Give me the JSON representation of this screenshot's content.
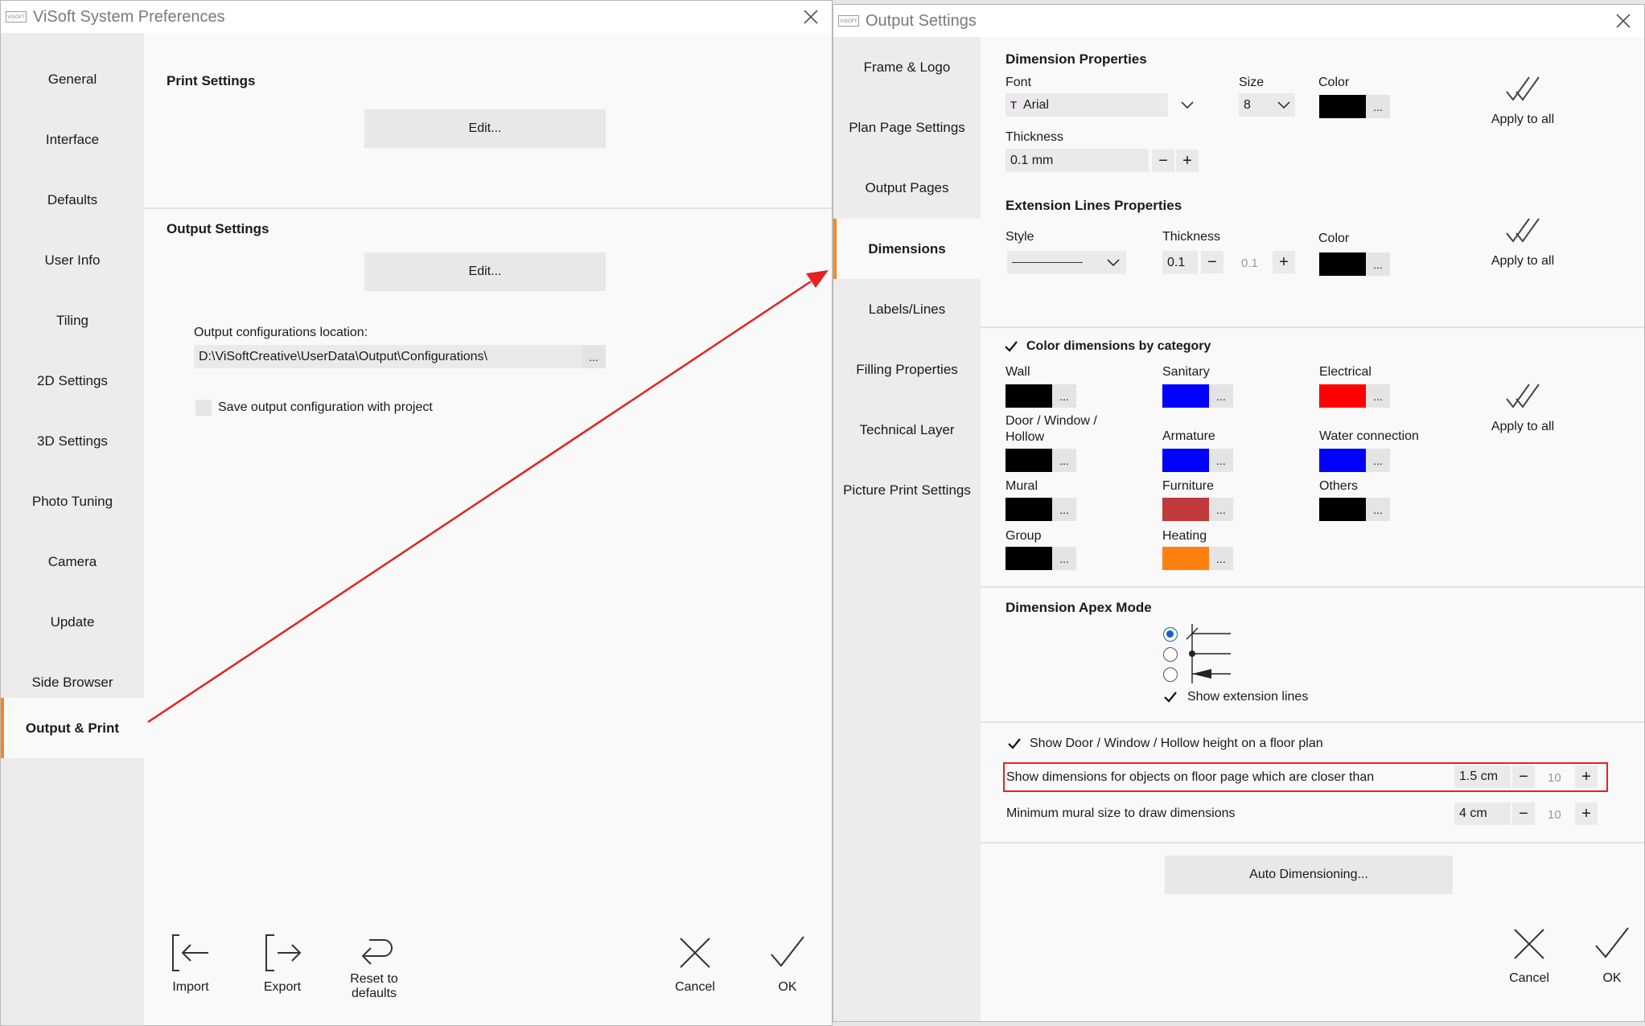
{
  "left_window": {
    "title": "ViSoft System Preferences",
    "logo": "VISOFT",
    "nav": [
      {
        "label": "General"
      },
      {
        "label": "Interface"
      },
      {
        "label": "Defaults"
      },
      {
        "label": "User Info"
      },
      {
        "label": "Tiling"
      },
      {
        "label": "2D Settings"
      },
      {
        "label": "3D Settings"
      },
      {
        "label": "Photo Tuning"
      },
      {
        "label": "Camera"
      },
      {
        "label": "Update"
      },
      {
        "label": "Side Browser"
      },
      {
        "label": "Output & Print"
      }
    ],
    "active_nav": "Output & Print",
    "print_settings": {
      "title": "Print Settings",
      "edit_label": "Edit..."
    },
    "output_settings": {
      "title": "Output Settings",
      "edit_label": "Edit...",
      "location_label": "Output configurations location:",
      "location_value": "D:\\ViSoftCreative\\UserData\\Output\\Configurations\\",
      "browse_label": "...",
      "save_with_project_label": "Save output configuration with project",
      "save_with_project_checked": false
    },
    "footer": {
      "import_label": "Import",
      "export_label": "Export",
      "reset_label": "Reset to\ndefaults",
      "cancel_label": "Cancel",
      "ok_label": "OK"
    }
  },
  "right_window": {
    "title": "Output Settings",
    "logo": "VISOFT",
    "nav": [
      {
        "label": "Frame & Logo"
      },
      {
        "label": "Plan Page Settings"
      },
      {
        "label": "Output Pages"
      },
      {
        "label": "Dimensions"
      },
      {
        "label": "Labels/Lines"
      },
      {
        "label": "Filling Properties"
      },
      {
        "label": "Technical Layer"
      },
      {
        "label": "Picture Print Settings"
      }
    ],
    "active_nav": "Dimensions",
    "dimension_properties": {
      "title": "Dimension Properties",
      "font_label": "Font",
      "font_value": "Arial",
      "size_label": "Size",
      "size_value": "8",
      "color_label": "Color",
      "color_value": "#000000",
      "thickness_label": "Thickness",
      "thickness_value": "0.1 mm",
      "apply_label": "Apply to all"
    },
    "extension_lines": {
      "title": "Extension Lines Properties",
      "style_label": "Style",
      "thickness_label": "Thickness",
      "thickness_value": "0.1",
      "thickness_step": "0.1",
      "color_label": "Color",
      "color_value": "#000000",
      "apply_label": "Apply to all"
    },
    "color_by_category": {
      "label": "Color dimensions by category",
      "checked": true,
      "apply_label": "Apply to all",
      "categories": [
        {
          "label": "Wall",
          "color": "#000000"
        },
        {
          "label": "Sanitary",
          "color": "#0000ff"
        },
        {
          "label": "Electrical",
          "color": "#ff0000"
        },
        {
          "label": "Door / Window / Hollow",
          "color": "#000000"
        },
        {
          "label": "Armature",
          "color": "#0000ff"
        },
        {
          "label": "Water connection",
          "color": "#0000ff"
        },
        {
          "label": "Mural",
          "color": "#000000"
        },
        {
          "label": "Furniture",
          "color": "#c0393b"
        },
        {
          "label": "Others",
          "color": "#000000"
        },
        {
          "label": "Group",
          "color": "#000000"
        },
        {
          "label": "Heating",
          "color": "#ff7f0e"
        }
      ]
    },
    "apex_mode": {
      "title": "Dimension Apex Mode",
      "selected_option": 1,
      "show_extension_lines_label": "Show extension lines",
      "show_extension_lines_checked": true
    },
    "floor_plan": {
      "show_height_label": "Show Door / Window / Hollow height on a floor plan",
      "show_height_checked": true,
      "closer_than_label": "Show dimensions for objects on floor page which are closer than",
      "closer_than_value": "1.5 cm",
      "closer_than_step": "10",
      "min_mural_label": "Minimum mural size to draw dimensions",
      "min_mural_value": "4 cm",
      "min_mural_step": "10"
    },
    "auto_dimensioning_label": "Auto Dimensioning...",
    "footer": {
      "cancel_label": "Cancel",
      "ok_label": "OK"
    }
  },
  "colors": {
    "active_accent": "#f08a24",
    "annotation_arrow": "#e52222",
    "highlight_box": "#e52222",
    "radio_selected": "#1565c0"
  }
}
